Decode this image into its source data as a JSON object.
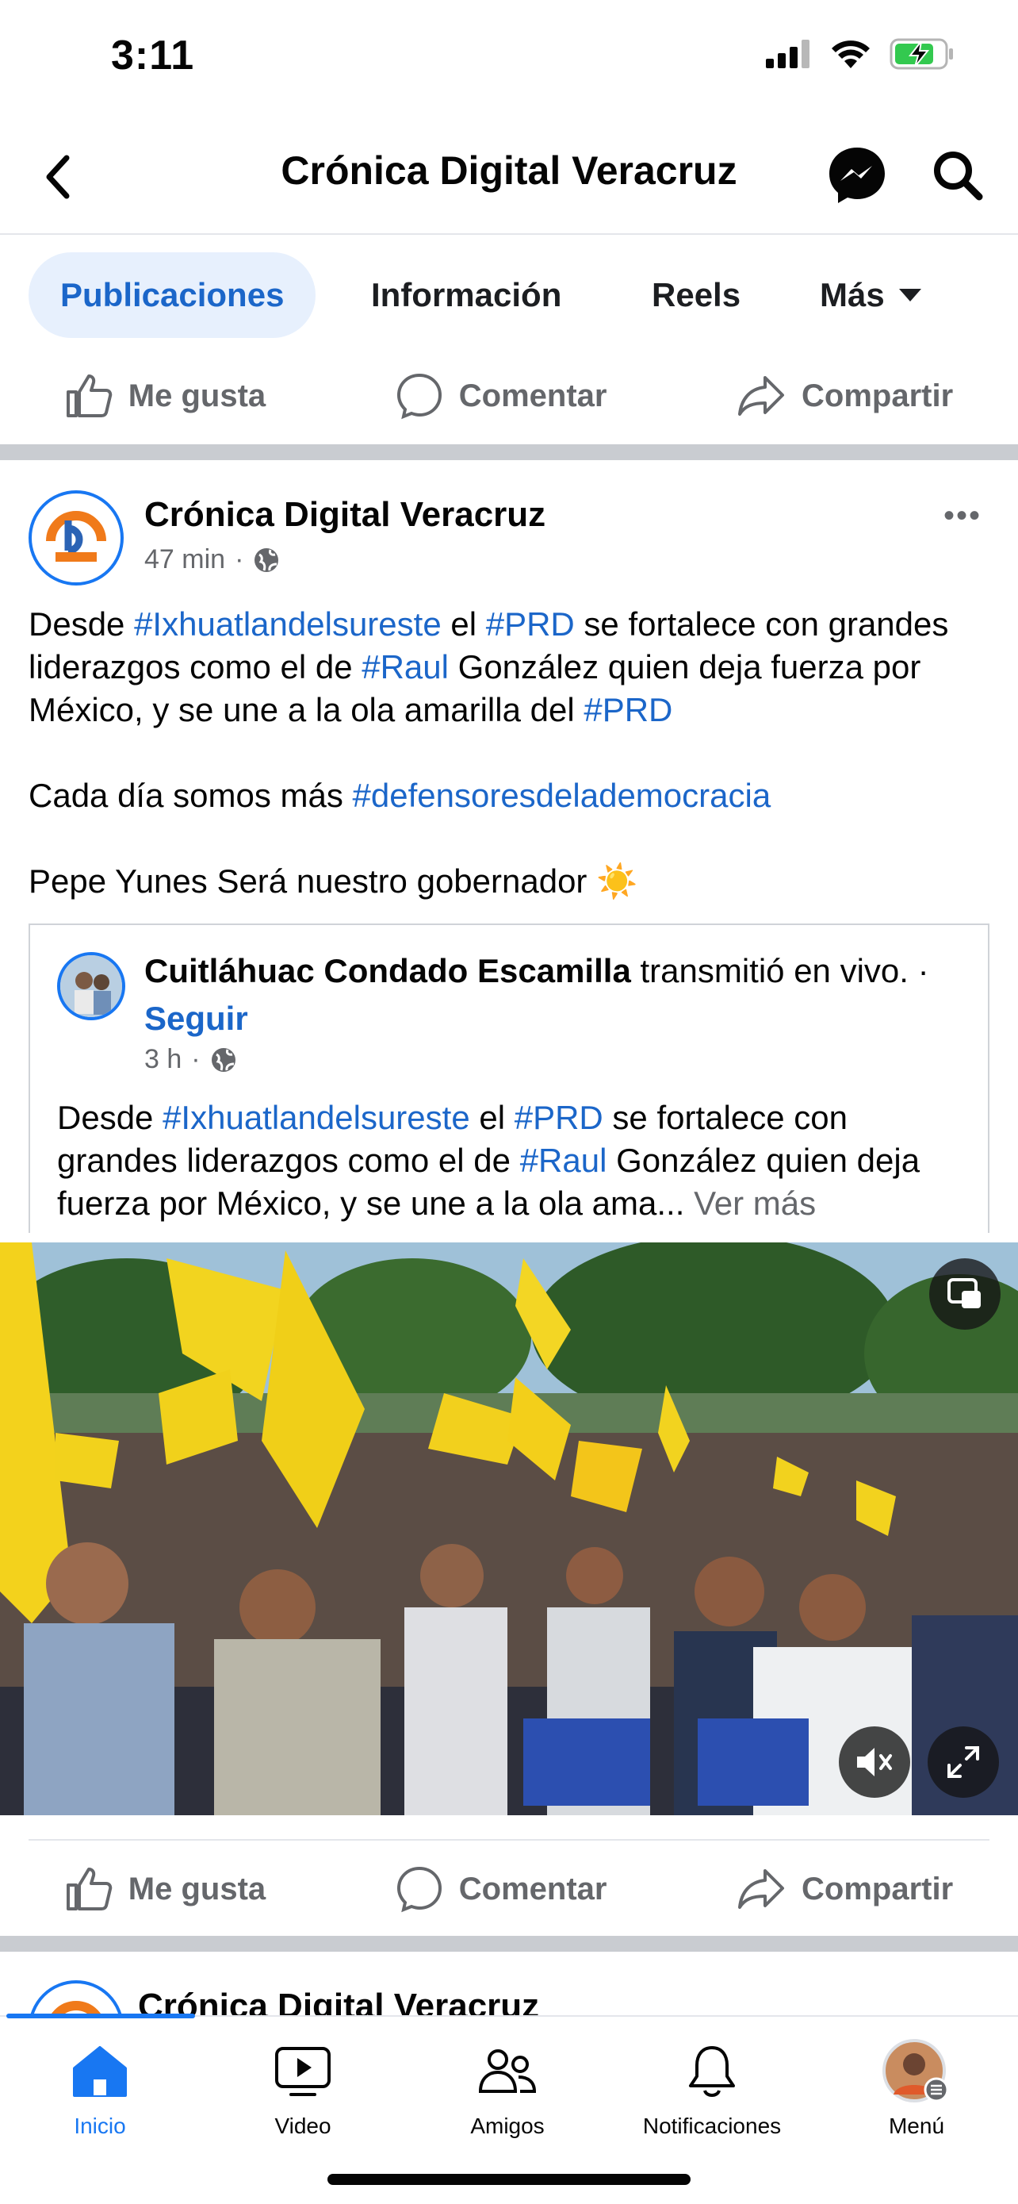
{
  "status_bar": {
    "time": "3:11"
  },
  "header": {
    "title": "Crónica Digital Veracruz"
  },
  "tabs": [
    {
      "label": "Publicaciones"
    },
    {
      "label": "Información"
    },
    {
      "label": "Reels"
    },
    {
      "label": "Más"
    }
  ],
  "actions": {
    "like": "Me gusta",
    "comment": "Comentar",
    "share": "Compartir"
  },
  "post": {
    "author": "Crónica Digital Veracruz",
    "time": "47 min",
    "para1": [
      {
        "t": "Desde ",
        "h": false
      },
      {
        "t": "#Ixhuatlandelsureste",
        "h": true
      },
      {
        "t": " el ",
        "h": false
      },
      {
        "t": "#PRD",
        "h": true
      },
      {
        "t": " se fortalece con grandes liderazgos como el de ",
        "h": false
      },
      {
        "t": "#Raul",
        "h": true
      },
      {
        "t": " González quien deja fuerza por México, y se une a la ola amarilla del ",
        "h": false
      },
      {
        "t": "#PRD",
        "h": true
      }
    ],
    "para2_text": "Cada día somos más ",
    "para2_tag": "#defensoresdelademocracia",
    "para3_text": "Pepe Yunes Será nuestro gobernador ",
    "para3_emoji": "☀️"
  },
  "shared": {
    "author": "Cuitláhuac Condado Escamilla",
    "action": " transmitió en vivo. · ",
    "follow": "Seguir",
    "time": "3 h",
    "text": [
      {
        "t": "Desde ",
        "h": false
      },
      {
        "t": "#Ixhuatlandelsureste",
        "h": true
      },
      {
        "t": " el ",
        "h": false
      },
      {
        "t": "#PRD",
        "h": true
      },
      {
        "t": " se fortalece con grandes liderazgos como el de ",
        "h": false
      },
      {
        "t": "#Raul",
        "h": true
      },
      {
        "t": " González quien deja fuerza por México, y se une a la ola ama...",
        "h": false
      }
    ],
    "see_more": " Ver más"
  },
  "next_post": {
    "author": "Crónica Digital Veracruz"
  },
  "bottom_nav": [
    {
      "label": "Inicio",
      "icon": "home-icon"
    },
    {
      "label": "Video",
      "icon": "video-icon"
    },
    {
      "label": "Amigos",
      "icon": "friends-icon"
    },
    {
      "label": "Notificaciones",
      "icon": "bell-icon"
    },
    {
      "label": "Menú",
      "icon": "menu-avatar"
    }
  ],
  "colors": {
    "accent": "#1877f2",
    "hashtag": "#1b66c9",
    "muted": "#65676b",
    "separator": "#c9ccd1"
  }
}
